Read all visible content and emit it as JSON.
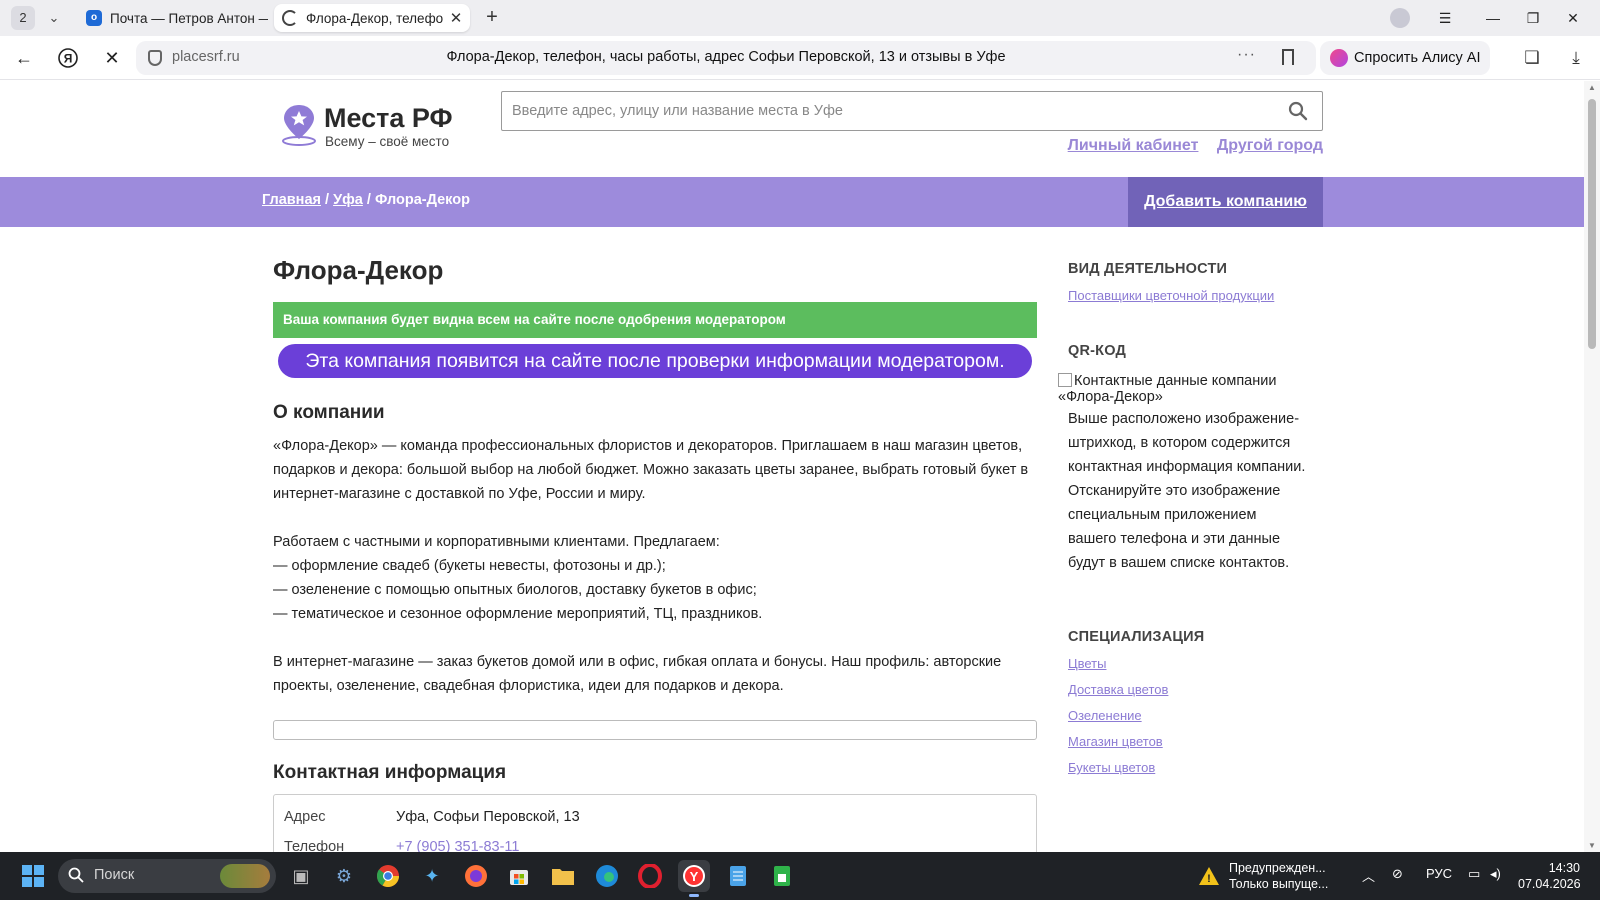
{
  "browser": {
    "tab_count": "2",
    "tabs": [
      {
        "title": "Почта — Петров Антон —",
        "icon": "mail-icon"
      },
      {
        "title": "Флора-Декор, телефо",
        "icon": "loading-spinner-icon"
      }
    ],
    "url_host": "placesrf.ru",
    "page_title": "Флора-Декор, телефон, часы работы, адрес Софьи Перовской, 13 и отзывы в Уфе",
    "alice_label": "Спросить Алису AI"
  },
  "site": {
    "logo_title": "Места РФ",
    "logo_subtitle": "Всему – своё место",
    "search_placeholder": "Введите адрес, улицу или название места в Уфе",
    "links": {
      "cabinet": "Личный кабинет",
      "city": "Другой город"
    },
    "breadcrumbs": {
      "home": "Главная",
      "sep1": " / ",
      "city": "Уфа",
      "sep2": " / ",
      "current": "Флора-Декор"
    },
    "add_company": "Добавить компанию",
    "accent_color": "#9d8bdc"
  },
  "company": {
    "name": "Флора-Декор",
    "notice_green": "Ваша компания будет видна всем на сайте после одобрения модератором",
    "notice_purple": "Эта компания появится на сайте после проверки информации модератором.",
    "about_heading": "О компании",
    "about_p1": "«Флора-Декор» — команда профессиональных флористов и декораторов. Приглашаем в наш магазин цветов, подарков и декора: большой выбор на любой бюджет. Можно заказать цветы заранее, выбрать готовый букет в интернет-магазине с доставкой по Уфе, России и миру.",
    "about_p2_intro": "Работаем с частными и корпоративными клиентами. Предлагаем:",
    "about_p2_items": [
      "— оформление свадеб (букеты невесты, фотозоны и др.);",
      "— озеленение с помощью опытных биологов, доставку букетов в офис;",
      "— тематическое и сезонное оформление мероприятий, ТЦ, праздников."
    ],
    "about_p3": "В интернет-магазине — заказ букетов домой или в офис, гибкая оплата и бонусы. Наш профиль: авторские проекты, озеленение, свадебная флористика, идеи для подарков и декора.",
    "contacts_heading": "Контактная информация",
    "contacts": [
      {
        "key": "Адрес",
        "value": "Уфа, Софьи Перовской, 13"
      },
      {
        "key": "Телефон",
        "value": "+7 (905) 351-83-11"
      }
    ]
  },
  "sidebar": {
    "activity_heading": "ВИД ДЕЯТЕЛЬНОСТИ",
    "activity_link": "Поставщики цветочной продукции",
    "qr_heading": "QR-КОД",
    "qr_alt": "Контактные данные компании «Флора-Декор»",
    "qr_desc": "Выше расположено изображение-штрихкод, в котором содержится контактная информация компании. Отсканируйте это изображение специальным приложением вашего телефона и эти данные будут в вашем списке контактов.",
    "spec_heading": "СПЕЦИАЛИЗАЦИЯ",
    "spec_links": [
      "Цветы",
      "Доставка цветов",
      "Озеленение",
      "Магазин цветов",
      "Букеты цветов"
    ]
  },
  "taskbar": {
    "search_label": "Поиск",
    "notification_title": "Предупрежден...",
    "notification_sub": "Только выпуще...",
    "language": "РУС",
    "time": "14:30",
    "date": "07.04.2026"
  }
}
